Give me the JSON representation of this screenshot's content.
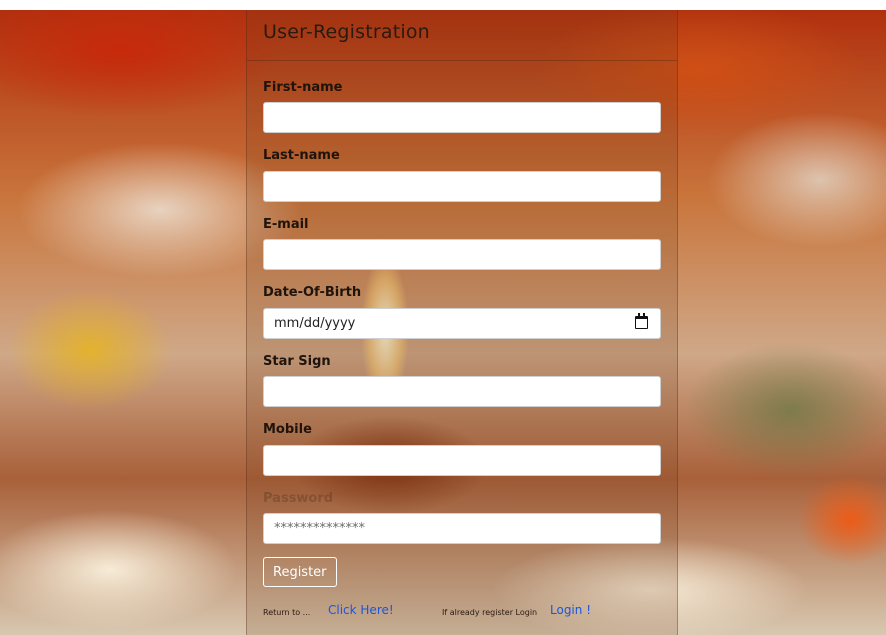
{
  "form": {
    "title": "User-Registration",
    "fields": [
      {
        "label": "First-name",
        "value": "",
        "placeholder": ""
      },
      {
        "label": "Last-name",
        "value": "",
        "placeholder": ""
      },
      {
        "label": "E-mail",
        "value": "",
        "placeholder": ""
      },
      {
        "label": "Date-Of-Birth",
        "value": "mm/dd/yyyy",
        "icon": "calendar-icon"
      },
      {
        "label": "Star Sign",
        "value": "",
        "placeholder": ""
      },
      {
        "label": "Mobile",
        "value": "",
        "placeholder": ""
      },
      {
        "label": "Password",
        "value": "",
        "placeholder": "**************"
      }
    ],
    "register_label": "Register",
    "footer": {
      "return_text": "Return to ...",
      "click_here_label": "Click Here!",
      "login_text": "If already register Login",
      "login_label": "Login !"
    }
  },
  "colors": {
    "link": "#1a55e0",
    "title": "#2a1a10"
  }
}
